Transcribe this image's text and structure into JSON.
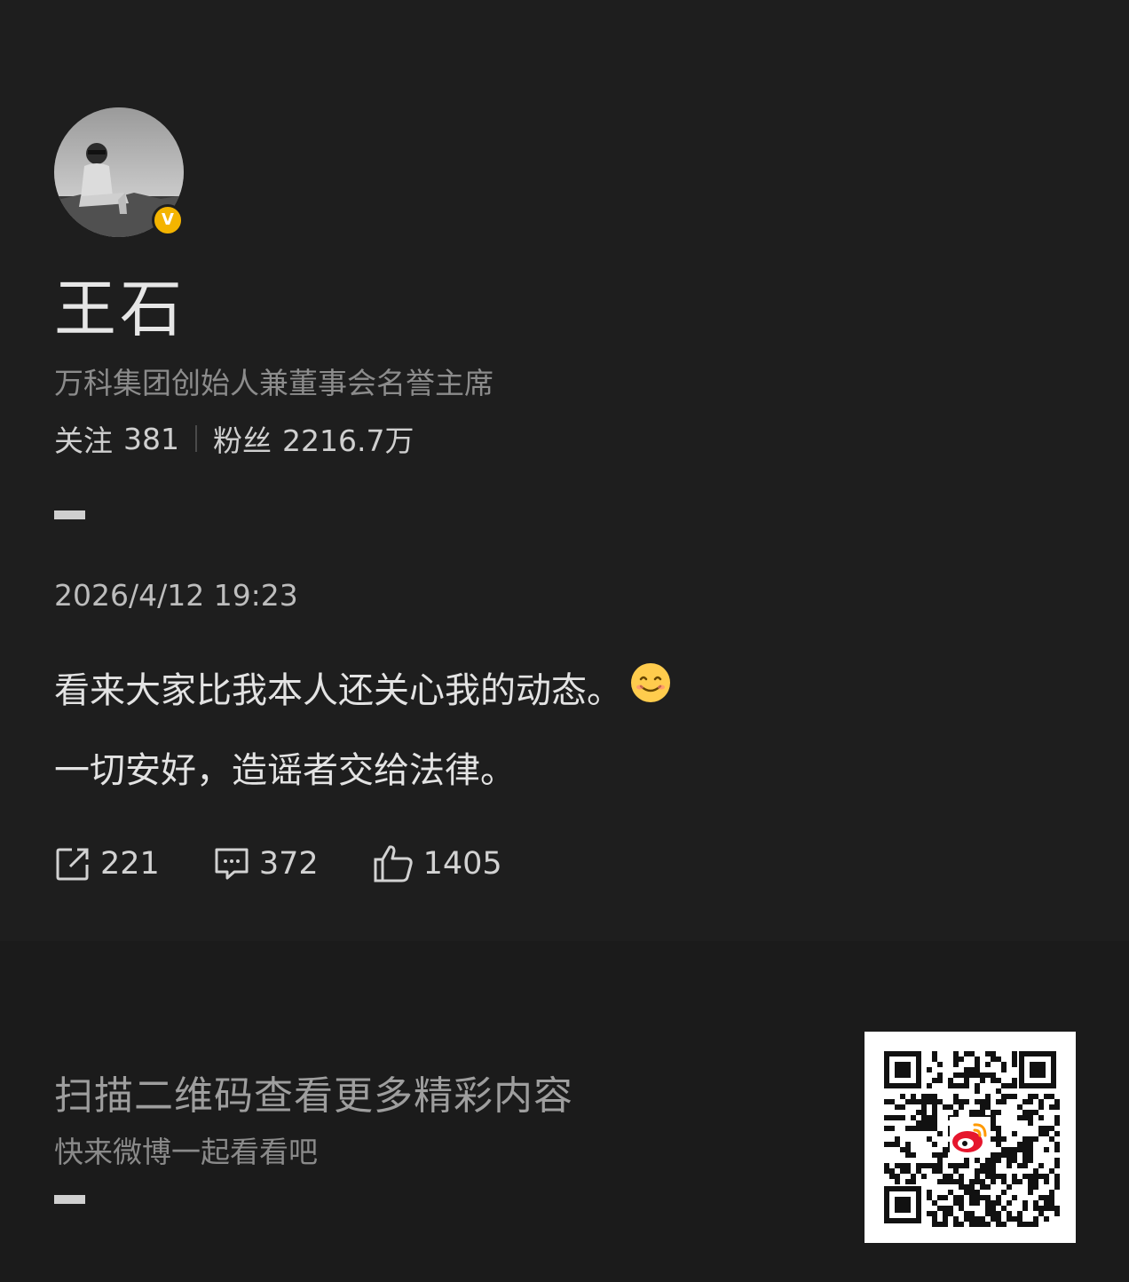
{
  "profile": {
    "name": "王石",
    "bio": "万科集团创始人兼董事会名誉主席",
    "following_label": "关注",
    "following_count": "381",
    "followers_label": "粉丝",
    "followers_count": "2216.7万",
    "verified_badge": "V"
  },
  "post": {
    "timestamp": "2026/4/12 19:23",
    "line1": "看来大家比我本人还关心我的动态。",
    "line2": "一切安好，造谣者交给法律。",
    "emoji": "smiling-face-icon",
    "reposts": "221",
    "comments": "372",
    "likes": "1405"
  },
  "footer": {
    "title": "扫描二维码查看更多精彩内容",
    "subtitle": "快来微博一起看看吧"
  },
  "colors": {
    "background": "#1e1e1e",
    "badge": "#f4b400",
    "weibo_red": "#e6162d",
    "weibo_orange": "#ff9a00"
  }
}
